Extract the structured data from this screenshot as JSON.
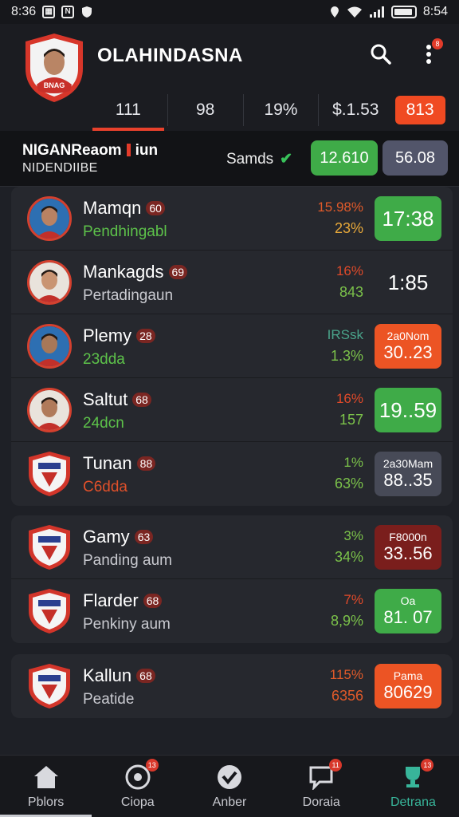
{
  "status_bar": {
    "time": "8:36",
    "right_time": "8:54",
    "icons": [
      "calendar-icon",
      "n-app-icon",
      "shield-icon",
      "location-icon",
      "wifi-icon",
      "signal-icon",
      "battery-icon"
    ]
  },
  "header": {
    "team_name": "OLAHINDASNA",
    "crest_text": "BNAG",
    "tabs": [
      "111",
      "98",
      "19%",
      "$.1.53"
    ],
    "tab_pill": "813",
    "search_icon": "search-icon",
    "menu_icon": "more-vert-icon",
    "menu_badge": "8"
  },
  "summary": {
    "title1_a": "NIGANReaom",
    "title1_b": "iun",
    "title2": "NIDENDIIBE",
    "status": "Samds",
    "btn_green": "12.610",
    "btn_grey": "56.08"
  },
  "groups": [
    {
      "rows": [
        {
          "name": "Mamqn",
          "badge": "60",
          "sub": "Pendhingabl",
          "sub_color": "#5dc24a",
          "stat1": "15.98%",
          "stat1_color": "#e05a2a",
          "stat2": "23%",
          "stat2_color": "#e8a93a",
          "score_top": "",
          "score": "17:38",
          "score_bg": "#3fab48",
          "avatar": "player"
        },
        {
          "name": "Mankagds",
          "badge": "69",
          "sub": "Pertadingaun",
          "sub_color": "#c9cad0",
          "stat1": "16%",
          "stat1_color": "#e04a2a",
          "stat2": "843",
          "stat2_color": "#7bc24a",
          "score_top": "",
          "score": "1:85",
          "score_bg": "transparent",
          "avatar": "player"
        },
        {
          "name": "Plemy",
          "badge": "28",
          "sub": "23dda",
          "sub_color": "#5dc24a",
          "stat1": "IRSsk",
          "stat1_color": "#4aa38a",
          "stat2": "1.3%",
          "stat2_color": "#7bc24a",
          "score_top": "2a0Nom",
          "score": "30..23",
          "score_bg": "#ec5424",
          "avatar": "player"
        },
        {
          "name": "Saltut",
          "badge": "68",
          "sub": "24dcn",
          "sub_color": "#5dc24a",
          "stat1": "16%",
          "stat1_color": "#e04a2a",
          "stat2": "157",
          "stat2_color": "#7bc24a",
          "score_top": "",
          "score": "19..59",
          "score_bg": "#3fab48",
          "avatar": "player"
        },
        {
          "name": "Tunan",
          "badge": "88",
          "sub": "C6dda",
          "sub_color": "#e0502a",
          "stat1": "1%",
          "stat1_color": "#7bc24a",
          "stat2": "63%",
          "stat2_color": "#7bc24a",
          "score_top": "2a30Mam",
          "score": "88..35",
          "score_bg": "#474a57",
          "avatar": "crest"
        }
      ]
    },
    {
      "rows": [
        {
          "name": "Gamy",
          "badge": "63",
          "sub": "Panding aum",
          "sub_color": "#c9cad0",
          "stat1": "3%",
          "stat1_color": "#7bc24a",
          "stat2": "34%",
          "stat2_color": "#7bc24a",
          "score_top": "F8000n",
          "score": "33..56",
          "score_bg": "#7a1e1c",
          "avatar": "crest"
        },
        {
          "name": "Flarder",
          "badge": "68",
          "sub": "Penkiny aum",
          "sub_color": "#c9cad0",
          "stat1": "7%",
          "stat1_color": "#e04a2a",
          "stat2": "8,9%",
          "stat2_color": "#7bc24a",
          "score_top": "Oa",
          "score": "81. 07",
          "score_bg": "#3fab48",
          "avatar": "crest"
        }
      ]
    },
    {
      "rows": [
        {
          "name": "Kallun",
          "badge": "68",
          "sub": "Peatide",
          "sub_color": "#c9cad0",
          "stat1": "115%",
          "stat1_color": "#e05a2a",
          "stat2": "6356",
          "stat2_color": "#e05a2a",
          "score_top": "Pama",
          "score": "80629",
          "score_bg": "#ec5424",
          "avatar": "crest"
        }
      ]
    }
  ],
  "bottom_nav": [
    {
      "label": "Pblors",
      "icon": "home-icon",
      "badge": ""
    },
    {
      "label": "Ciopa",
      "icon": "ball-icon",
      "badge": "13"
    },
    {
      "label": "Anber",
      "icon": "check-circle-icon",
      "badge": ""
    },
    {
      "label": "Doraia",
      "icon": "chat-icon",
      "badge": "11"
    },
    {
      "label": "Detrana",
      "icon": "trophy-icon",
      "badge": "13"
    }
  ]
}
